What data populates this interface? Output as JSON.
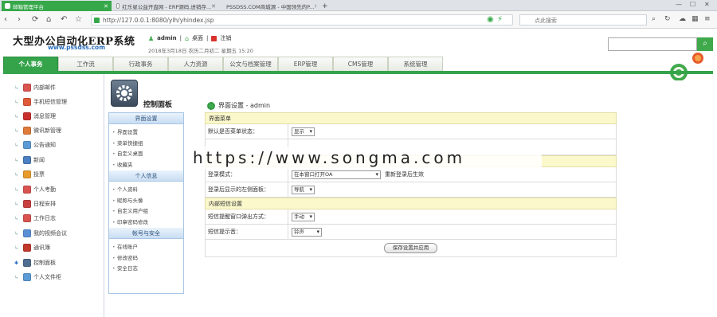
{
  "browser": {
    "tabs": [
      {
        "label": "邮箱管理平台",
        "active": true
      },
      {
        "label": "红乐星公益开盘网 - ERP源码,进销存...",
        "active": false
      },
      {
        "label": "PSSDSS.COM商城源 - 中国领先的P...",
        "active": false
      }
    ],
    "new_tab": "+",
    "url": "http://127.0.0.1:8080/ylh/yhindex.jsp",
    "search_placeholder": "点此搜索"
  },
  "site": {
    "logo_title": "大型办公自动化ERP系统",
    "logo_url": "www.pssdss.com",
    "user": "admin",
    "desktop_link": "桌面",
    "logout_link": "注销",
    "date_text": "2018年3月18日  农历二月初二  星期五  15:20",
    "nav": [
      "个人事务",
      "工作流",
      "行政事务",
      "人力资源",
      "公文与档案管理",
      "ERP管理",
      "CMS管理",
      "系统管理"
    ]
  },
  "sidebar": {
    "items": [
      {
        "label": "内部邮件",
        "color": "#d9534f"
      },
      {
        "label": "手机短信管理",
        "color": "#e05a3a"
      },
      {
        "label": "消息管理",
        "color": "#c9302c"
      },
      {
        "label": "微讯新管理",
        "color": "#e07b39"
      },
      {
        "label": "公告通知",
        "color": "#5b9bd5"
      },
      {
        "label": "新闻",
        "color": "#4a7fc1"
      },
      {
        "label": "投票",
        "color": "#e89b2c"
      },
      {
        "label": "个人考勤",
        "color": "#d9534f"
      },
      {
        "label": "日程安排",
        "color": "#c94040"
      },
      {
        "label": "工作日志",
        "color": "#d9534f"
      },
      {
        "label": "我的视频会议",
        "color": "#5a8fd6"
      },
      {
        "label": "通讯簿",
        "color": "#c0392b"
      },
      {
        "label": "控制面板",
        "color": "#4f6d8f"
      },
      {
        "label": "个人文件柜",
        "color": "#5b9bd5"
      }
    ]
  },
  "panel": {
    "title": "控制面板",
    "groups": [
      {
        "head": "界面设置",
        "links": [
          "界面设置",
          "菜单快捷组",
          "自定义桌面",
          "收藏夹"
        ]
      },
      {
        "head": "个人信息",
        "links": [
          "个人资料",
          "昵称与头像",
          "自定义用户组",
          "印章密码修改"
        ]
      },
      {
        "head": "帐号与安全",
        "links": [
          "在线账户",
          "修改密码",
          "安全日志"
        ]
      }
    ]
  },
  "form": {
    "title": "界面设置 - admin",
    "sec1": "界面菜单",
    "row1_label": "默认是否菜单状态：",
    "row1_value": "显示",
    "sec2": "",
    "row2_label": "登录模式：",
    "row2_value": "在本窗口打开OA",
    "row2_hint": "重新登录后生效",
    "row3_label": "登录后显示的左侧面板：",
    "row3_value": "导航",
    "sec3": "内部短信设置",
    "row4_label": "短信提醒窗口弹出方式：",
    "row4_value": "手动",
    "row5_label": "短信提示音：",
    "row5_value": "铃声",
    "save_label": "保存设置并应用"
  },
  "watermark": "https://www.songma.com"
}
